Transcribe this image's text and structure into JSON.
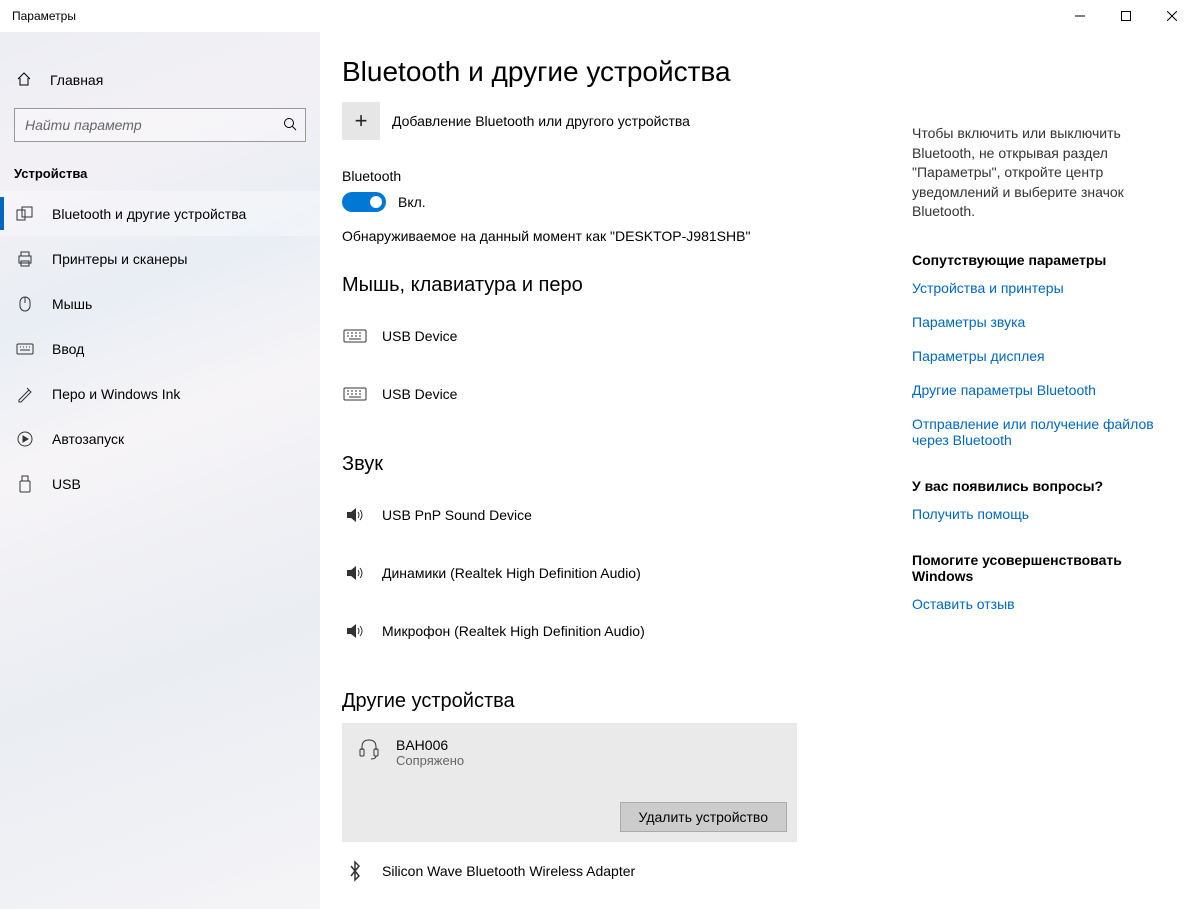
{
  "window": {
    "title": "Параметры"
  },
  "sidebar": {
    "home": "Главная",
    "search_placeholder": "Найти параметр",
    "category": "Устройства",
    "items": [
      {
        "label": "Bluetooth и другие устройства",
        "icon": "bluetooth-devices-icon",
        "selected": true
      },
      {
        "label": "Принтеры и сканеры",
        "icon": "printer-icon"
      },
      {
        "label": "Мышь",
        "icon": "mouse-icon"
      },
      {
        "label": "Ввод",
        "icon": "keyboard-icon"
      },
      {
        "label": "Перо и Windows Ink",
        "icon": "pen-icon"
      },
      {
        "label": "Автозапуск",
        "icon": "autoplay-icon"
      },
      {
        "label": "USB",
        "icon": "usb-icon"
      }
    ]
  },
  "main": {
    "title": "Bluetooth и другие устройства",
    "add_device": "Добавление Bluetooth или другого устройства",
    "bt_label": "Bluetooth",
    "bt_state": "Вкл.",
    "discoverable": "Обнаруживаемое на данный момент как \"DESKTOP-J981SHB\"",
    "groups": {
      "input": {
        "title": "Мышь, клавиатура и перо",
        "items": [
          {
            "name": "USB Device",
            "icon": "keyboard"
          },
          {
            "name": "USB Device",
            "icon": "keyboard"
          }
        ]
      },
      "audio": {
        "title": "Звук",
        "items": [
          {
            "name": "USB PnP Sound Device",
            "icon": "speaker"
          },
          {
            "name": "Динамики (Realtek High Definition Audio)",
            "icon": "speaker"
          },
          {
            "name": "Микрофон (Realtek High Definition Audio)",
            "icon": "speaker"
          }
        ]
      },
      "other": {
        "title": "Другие устройства",
        "items": [
          {
            "name": "BAH006",
            "status": "Сопряжено",
            "icon": "headset",
            "selected": true,
            "action": "Удалить устройство"
          },
          {
            "name": "Silicon Wave Bluetooth Wireless Adapter",
            "icon": "bluetooth"
          }
        ]
      }
    }
  },
  "right": {
    "tip": "Чтобы включить или выключить Bluetooth, не открывая раздел \"Параметры\", откройте центр уведомлений и выберите значок Bluetooth.",
    "related_title": "Сопутствующие параметры",
    "related_links": [
      "Устройства и принтеры",
      "Параметры звука",
      "Параметры дисплея",
      "Другие параметры Bluetooth",
      "Отправление или получение файлов через Bluetooth"
    ],
    "help_title": "У вас появились вопросы?",
    "help_link": "Получить помощь",
    "feedback_title": "Помогите усовершенствовать Windows",
    "feedback_link": "Оставить отзыв"
  }
}
